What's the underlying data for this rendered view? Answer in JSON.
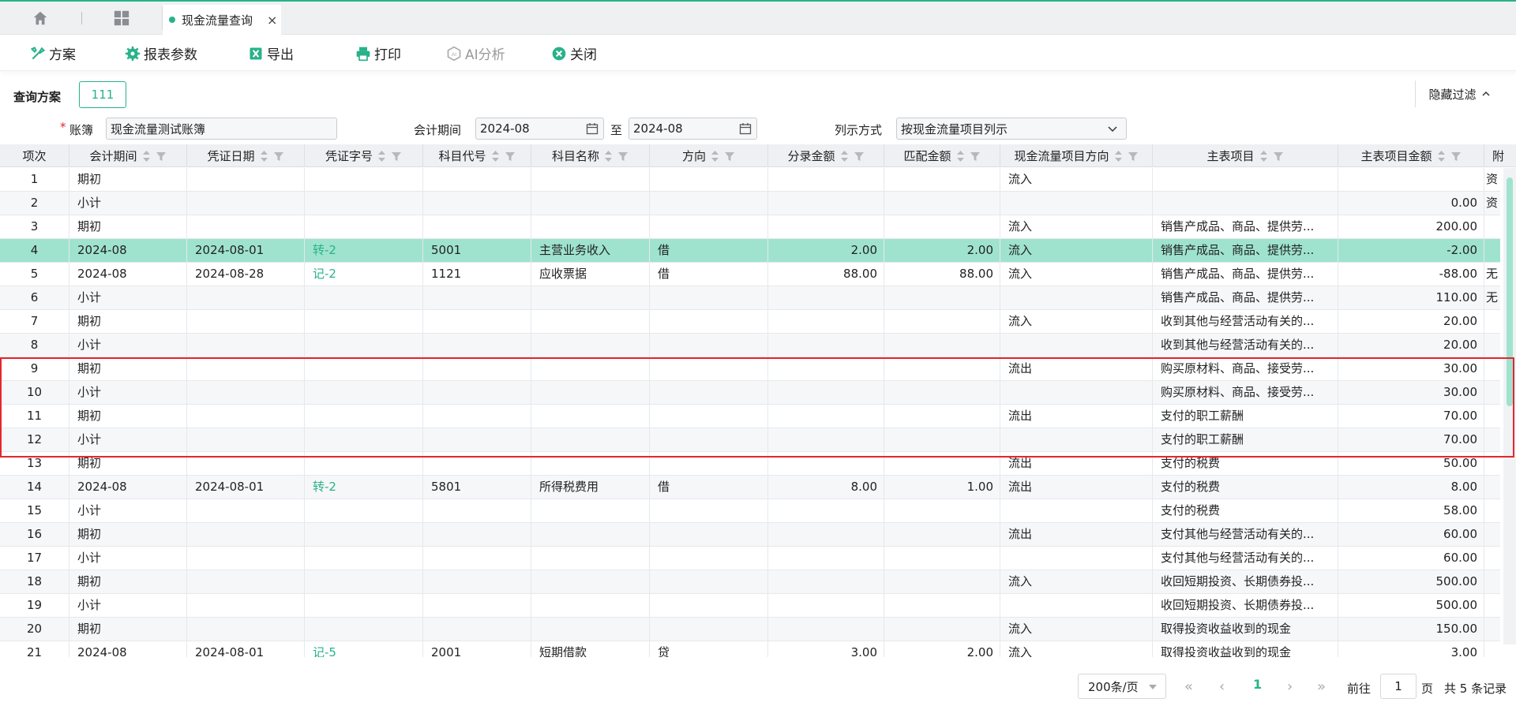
{
  "tabs": [
    {
      "label": "现金流量查询",
      "close": "×"
    }
  ],
  "toolbar": {
    "scheme": "方案",
    "report_params": "报表参数",
    "export": "导出",
    "print": "打印",
    "ai": "AI分析",
    "close": "关闭"
  },
  "filters": {
    "scheme_label": "查询方案",
    "scheme_value": "111",
    "hide_filter": "隐藏过滤",
    "ledger_label": "账簿",
    "required_mark": "*",
    "ledger_value": "现金流量测试账簿",
    "period_label": "会计期间",
    "period_from": "2024-08",
    "to_label": "至",
    "period_to": "2024-08",
    "display_label": "列示方式",
    "display_value": "按现金流量项目列示"
  },
  "columns": [
    "项次",
    "会计期间",
    "凭证日期",
    "凭证字号",
    "科目代号",
    "科目名称",
    "方向",
    "分录金额",
    "匹配金额",
    "现金流量项目方向",
    "主表项目",
    "主表项目金额",
    "附"
  ],
  "rows": [
    [
      "1",
      "期初",
      "",
      "",
      "",
      "",
      "",
      "",
      "",
      "流入",
      "",
      "",
      "资"
    ],
    [
      "2",
      "小计",
      "",
      "",
      "",
      "",
      "",
      "",
      "",
      "",
      "",
      "0.00",
      "资"
    ],
    [
      "3",
      "期初",
      "",
      "",
      "",
      "",
      "",
      "",
      "",
      "流入",
      "销售产成品、商品、提供劳...",
      "200.00",
      ""
    ],
    [
      "4",
      "2024-08",
      "2024-08-01",
      "转-2",
      "5001",
      "主营业务收入",
      "借",
      "2.00",
      "2.00",
      "流入",
      "销售产成品、商品、提供劳...",
      "-2.00",
      ""
    ],
    [
      "5",
      "2024-08",
      "2024-08-28",
      "记-2",
      "1121",
      "应收票据",
      "借",
      "88.00",
      "88.00",
      "流入",
      "销售产成品、商品、提供劳...",
      "-88.00",
      "无"
    ],
    [
      "6",
      "小计",
      "",
      "",
      "",
      "",
      "",
      "",
      "",
      "",
      "销售产成品、商品、提供劳...",
      "110.00",
      "无"
    ],
    [
      "7",
      "期初",
      "",
      "",
      "",
      "",
      "",
      "",
      "",
      "流入",
      "收到其他与经营活动有关的...",
      "20.00",
      ""
    ],
    [
      "8",
      "小计",
      "",
      "",
      "",
      "",
      "",
      "",
      "",
      "",
      "收到其他与经营活动有关的...",
      "20.00",
      ""
    ],
    [
      "9",
      "期初",
      "",
      "",
      "",
      "",
      "",
      "",
      "",
      "流出",
      "购买原材料、商品、接受劳...",
      "30.00",
      ""
    ],
    [
      "10",
      "小计",
      "",
      "",
      "",
      "",
      "",
      "",
      "",
      "",
      "购买原材料、商品、接受劳...",
      "30.00",
      ""
    ],
    [
      "11",
      "期初",
      "",
      "",
      "",
      "",
      "",
      "",
      "",
      "流出",
      "支付的职工薪酬",
      "70.00",
      ""
    ],
    [
      "12",
      "小计",
      "",
      "",
      "",
      "",
      "",
      "",
      "",
      "",
      "支付的职工薪酬",
      "70.00",
      ""
    ],
    [
      "13",
      "期初",
      "",
      "",
      "",
      "",
      "",
      "",
      "",
      "流出",
      "支付的税费",
      "50.00",
      ""
    ],
    [
      "14",
      "2024-08",
      "2024-08-01",
      "转-2",
      "5801",
      "所得税费用",
      "借",
      "8.00",
      "1.00",
      "流出",
      "支付的税费",
      "8.00",
      ""
    ],
    [
      "15",
      "小计",
      "",
      "",
      "",
      "",
      "",
      "",
      "",
      "",
      "支付的税费",
      "58.00",
      ""
    ],
    [
      "16",
      "期初",
      "",
      "",
      "",
      "",
      "",
      "",
      "",
      "流出",
      "支付其他与经营活动有关的...",
      "60.00",
      ""
    ],
    [
      "17",
      "小计",
      "",
      "",
      "",
      "",
      "",
      "",
      "",
      "",
      "支付其他与经营活动有关的...",
      "60.00",
      ""
    ],
    [
      "18",
      "期初",
      "",
      "",
      "",
      "",
      "",
      "",
      "",
      "流入",
      "收回短期投资、长期债券投...",
      "500.00",
      ""
    ],
    [
      "19",
      "小计",
      "",
      "",
      "",
      "",
      "",
      "",
      "",
      "",
      "收回短期投资、长期债券投...",
      "500.00",
      ""
    ],
    [
      "20",
      "期初",
      "",
      "",
      "",
      "",
      "",
      "",
      "",
      "流入",
      "取得投资收益收到的现金",
      "150.00",
      ""
    ],
    [
      "21",
      "2024-08",
      "2024-08-01",
      "记-5",
      "2001",
      "短期借款",
      "贷",
      "3.00",
      "2.00",
      "流入",
      "取得投资收益收到的现金",
      "3.00",
      ""
    ]
  ],
  "selected_row": "4",
  "pager": {
    "page_size": "200条/页",
    "current": "1",
    "goto_label": "前往",
    "goto_value": "1",
    "page_unit": "页",
    "total": "共 5 条记录"
  },
  "colors": {
    "accent": "#28b28a",
    "selected": "#9fe3cf",
    "highlight_box": "#e5262c"
  }
}
